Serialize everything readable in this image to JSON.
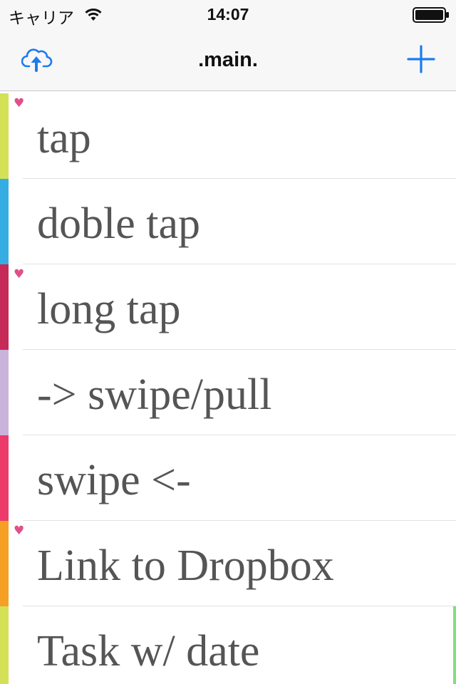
{
  "status_bar": {
    "carrier": "キャリア",
    "time": "14:07",
    "wifi_icon": "wifi-icon",
    "battery_icon": "battery-full-icon"
  },
  "nav_bar": {
    "title": ".main.",
    "left_icon": "cloud-upload-icon",
    "right_icon": "plus-icon"
  },
  "colors": {
    "accent": "#1a7cf0",
    "heart": "#e0508a",
    "text": "#555555",
    "date_indicator": "#7ee07e"
  },
  "tasks": [
    {
      "label": "tap",
      "color": "#d4e157",
      "favorite": true,
      "heart": "♥"
    },
    {
      "label": "doble tap",
      "color": "#35ade3",
      "favorite": false,
      "heart": ""
    },
    {
      "label": "long tap",
      "color": "#c62a56",
      "favorite": true,
      "heart": "♥"
    },
    {
      "label": "-> swipe/pull",
      "color": "#c9b3db",
      "favorite": false,
      "heart": ""
    },
    {
      "label": "swipe <-",
      "color": "#ec3a6a",
      "favorite": false,
      "heart": ""
    },
    {
      "label": "Link to Dropbox",
      "color": "#f5a024",
      "favorite": true,
      "heart": "♥"
    },
    {
      "label": "Task w/ date",
      "color": "#d4e157",
      "favorite": false,
      "heart": "",
      "has_date": true
    }
  ]
}
